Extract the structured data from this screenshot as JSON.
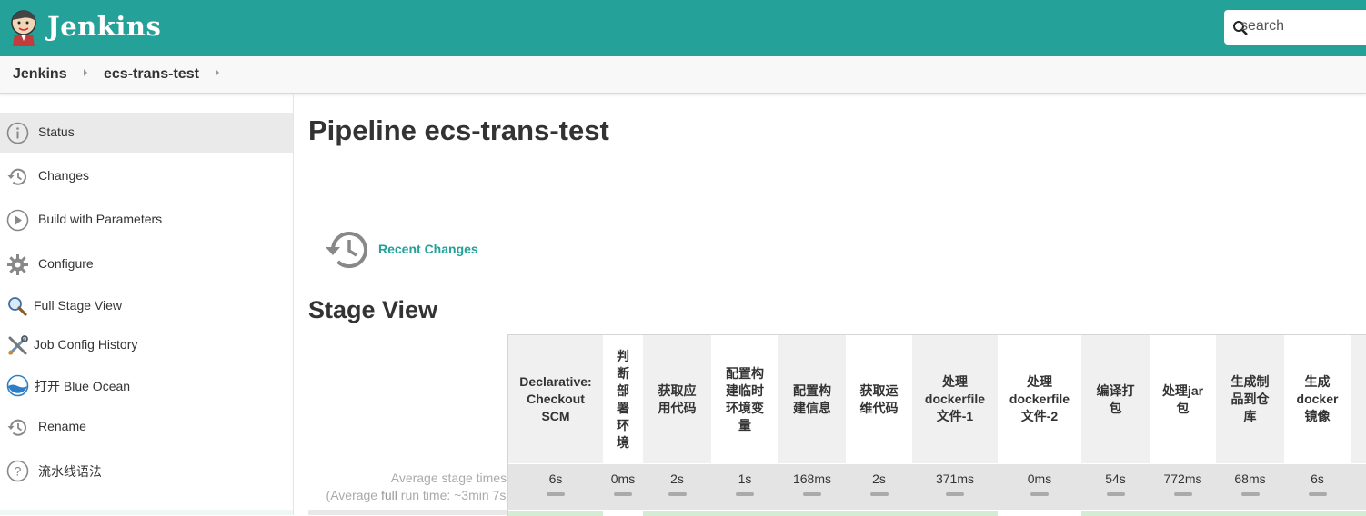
{
  "header": {
    "brand": "Jenkins",
    "search_placeholder": "search"
  },
  "breadcrumb": {
    "items": [
      "Jenkins",
      "ecs-trans-test"
    ]
  },
  "sidebar": {
    "items": [
      {
        "label": "Status",
        "icon": "info-icon",
        "active": true
      },
      {
        "label": "Changes",
        "icon": "history-icon"
      },
      {
        "label": "Build with Parameters",
        "icon": "play-icon"
      },
      {
        "label": "Configure",
        "icon": "gear-icon"
      },
      {
        "label": "Full Stage View",
        "icon": "magnifier-icon"
      },
      {
        "label": "Job Config History",
        "icon": "tools-icon"
      },
      {
        "label": "打开 Blue Ocean",
        "icon": "blue-ocean-icon"
      },
      {
        "label": "Rename",
        "icon": "history-icon"
      },
      {
        "label": "流水线语法",
        "icon": "help-icon"
      }
    ]
  },
  "main": {
    "title": "Pipeline ecs-trans-test",
    "recent_changes": "Recent Changes",
    "stage_view_title": "Stage View",
    "avg_stage_times": "Average stage times:",
    "avg_full_prefix": "(Average ",
    "avg_full_link": "full",
    "avg_full_suffix": " run time: ~3min 7s)"
  },
  "stages": [
    {
      "name": "Declarative: Checkout SCM",
      "time": "6s"
    },
    {
      "name": "判断部署环境",
      "time": "0ms"
    },
    {
      "name": "获取应用代码",
      "time": "2s"
    },
    {
      "name": "配置构建临时环境变量",
      "time": "1s"
    },
    {
      "name": "配置构建信息",
      "time": "168ms"
    },
    {
      "name": "获取运维代码",
      "time": "2s"
    },
    {
      "name": "处理dockerfile文件-1",
      "time": "371ms"
    },
    {
      "name": "处理dockerfile文件-2",
      "time": "0ms"
    },
    {
      "name": "编译打包",
      "time": "54s"
    },
    {
      "name": "处理jar包",
      "time": "772ms"
    },
    {
      "name": "生成制品到仓库",
      "time": "68ms"
    },
    {
      "name": "生成docker镜像",
      "time": "6s"
    }
  ],
  "colors": {
    "header_bg": "#24a198",
    "link": "#24a198"
  }
}
